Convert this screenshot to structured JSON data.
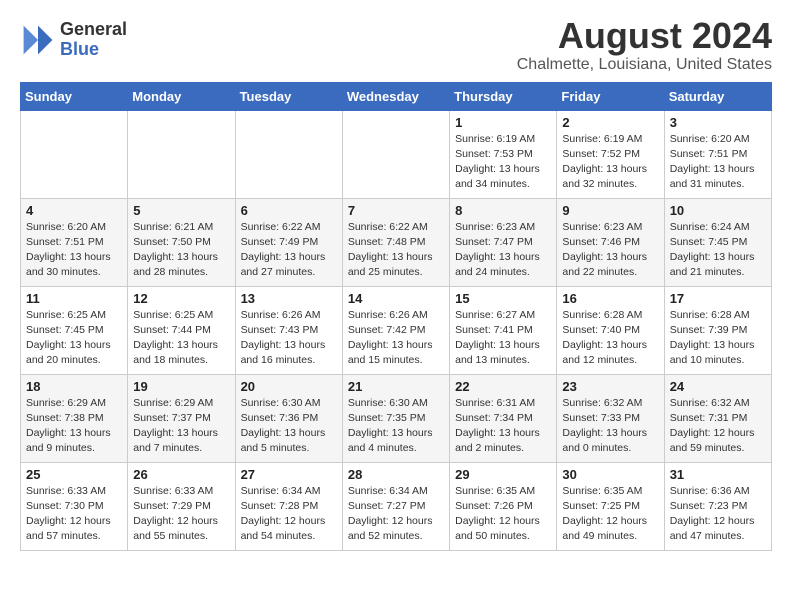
{
  "logo": {
    "general": "General",
    "blue": "Blue"
  },
  "title": "August 2024",
  "location": "Chalmette, Louisiana, United States",
  "days_of_week": [
    "Sunday",
    "Monday",
    "Tuesday",
    "Wednesday",
    "Thursday",
    "Friday",
    "Saturday"
  ],
  "weeks": [
    [
      {
        "day": "",
        "info": ""
      },
      {
        "day": "",
        "info": ""
      },
      {
        "day": "",
        "info": ""
      },
      {
        "day": "",
        "info": ""
      },
      {
        "day": "1",
        "info": "Sunrise: 6:19 AM\nSunset: 7:53 PM\nDaylight: 13 hours\nand 34 minutes."
      },
      {
        "day": "2",
        "info": "Sunrise: 6:19 AM\nSunset: 7:52 PM\nDaylight: 13 hours\nand 32 minutes."
      },
      {
        "day": "3",
        "info": "Sunrise: 6:20 AM\nSunset: 7:51 PM\nDaylight: 13 hours\nand 31 minutes."
      }
    ],
    [
      {
        "day": "4",
        "info": "Sunrise: 6:20 AM\nSunset: 7:51 PM\nDaylight: 13 hours\nand 30 minutes."
      },
      {
        "day": "5",
        "info": "Sunrise: 6:21 AM\nSunset: 7:50 PM\nDaylight: 13 hours\nand 28 minutes."
      },
      {
        "day": "6",
        "info": "Sunrise: 6:22 AM\nSunset: 7:49 PM\nDaylight: 13 hours\nand 27 minutes."
      },
      {
        "day": "7",
        "info": "Sunrise: 6:22 AM\nSunset: 7:48 PM\nDaylight: 13 hours\nand 25 minutes."
      },
      {
        "day": "8",
        "info": "Sunrise: 6:23 AM\nSunset: 7:47 PM\nDaylight: 13 hours\nand 24 minutes."
      },
      {
        "day": "9",
        "info": "Sunrise: 6:23 AM\nSunset: 7:46 PM\nDaylight: 13 hours\nand 22 minutes."
      },
      {
        "day": "10",
        "info": "Sunrise: 6:24 AM\nSunset: 7:45 PM\nDaylight: 13 hours\nand 21 minutes."
      }
    ],
    [
      {
        "day": "11",
        "info": "Sunrise: 6:25 AM\nSunset: 7:45 PM\nDaylight: 13 hours\nand 20 minutes."
      },
      {
        "day": "12",
        "info": "Sunrise: 6:25 AM\nSunset: 7:44 PM\nDaylight: 13 hours\nand 18 minutes."
      },
      {
        "day": "13",
        "info": "Sunrise: 6:26 AM\nSunset: 7:43 PM\nDaylight: 13 hours\nand 16 minutes."
      },
      {
        "day": "14",
        "info": "Sunrise: 6:26 AM\nSunset: 7:42 PM\nDaylight: 13 hours\nand 15 minutes."
      },
      {
        "day": "15",
        "info": "Sunrise: 6:27 AM\nSunset: 7:41 PM\nDaylight: 13 hours\nand 13 minutes."
      },
      {
        "day": "16",
        "info": "Sunrise: 6:28 AM\nSunset: 7:40 PM\nDaylight: 13 hours\nand 12 minutes."
      },
      {
        "day": "17",
        "info": "Sunrise: 6:28 AM\nSunset: 7:39 PM\nDaylight: 13 hours\nand 10 minutes."
      }
    ],
    [
      {
        "day": "18",
        "info": "Sunrise: 6:29 AM\nSunset: 7:38 PM\nDaylight: 13 hours\nand 9 minutes."
      },
      {
        "day": "19",
        "info": "Sunrise: 6:29 AM\nSunset: 7:37 PM\nDaylight: 13 hours\nand 7 minutes."
      },
      {
        "day": "20",
        "info": "Sunrise: 6:30 AM\nSunset: 7:36 PM\nDaylight: 13 hours\nand 5 minutes."
      },
      {
        "day": "21",
        "info": "Sunrise: 6:30 AM\nSunset: 7:35 PM\nDaylight: 13 hours\nand 4 minutes."
      },
      {
        "day": "22",
        "info": "Sunrise: 6:31 AM\nSunset: 7:34 PM\nDaylight: 13 hours\nand 2 minutes."
      },
      {
        "day": "23",
        "info": "Sunrise: 6:32 AM\nSunset: 7:33 PM\nDaylight: 13 hours\nand 0 minutes."
      },
      {
        "day": "24",
        "info": "Sunrise: 6:32 AM\nSunset: 7:31 PM\nDaylight: 12 hours\nand 59 minutes."
      }
    ],
    [
      {
        "day": "25",
        "info": "Sunrise: 6:33 AM\nSunset: 7:30 PM\nDaylight: 12 hours\nand 57 minutes."
      },
      {
        "day": "26",
        "info": "Sunrise: 6:33 AM\nSunset: 7:29 PM\nDaylight: 12 hours\nand 55 minutes."
      },
      {
        "day": "27",
        "info": "Sunrise: 6:34 AM\nSunset: 7:28 PM\nDaylight: 12 hours\nand 54 minutes."
      },
      {
        "day": "28",
        "info": "Sunrise: 6:34 AM\nSunset: 7:27 PM\nDaylight: 12 hours\nand 52 minutes."
      },
      {
        "day": "29",
        "info": "Sunrise: 6:35 AM\nSunset: 7:26 PM\nDaylight: 12 hours\nand 50 minutes."
      },
      {
        "day": "30",
        "info": "Sunrise: 6:35 AM\nSunset: 7:25 PM\nDaylight: 12 hours\nand 49 minutes."
      },
      {
        "day": "31",
        "info": "Sunrise: 6:36 AM\nSunset: 7:23 PM\nDaylight: 12 hours\nand 47 minutes."
      }
    ]
  ]
}
